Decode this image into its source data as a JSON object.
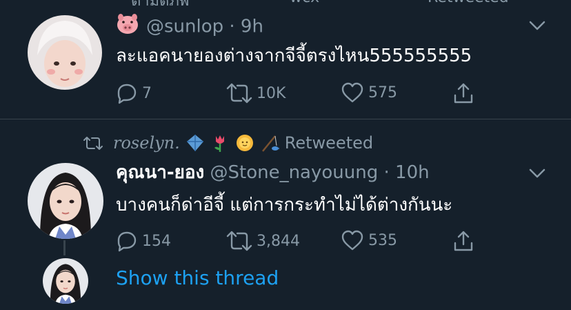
{
  "top_clipped": {
    "left_text": "ตามดูภพ",
    "middle_text": "wcx",
    "right_text": "Retweeted"
  },
  "tweet1": {
    "emoji": "pig",
    "handle": "@sunlop",
    "time": "· 9h",
    "text": "ละแอคนายองต่างจากจีจี้ตรงไหน555555555",
    "replies": "7",
    "retweets": "10K",
    "likes": "575"
  },
  "tweet2": {
    "retweeted_by": "roselyn.",
    "retweeted_label": "Retweeted",
    "display_name": "คุณนา-ยอง",
    "handle": "@Stone_nayouung",
    "time": "· 10h",
    "text": "บางคนก็ด่าอีจี้ แต่การกระทำไม่ได้ต่างกันนะ",
    "replies": "154",
    "retweets": "3,844",
    "likes": "535"
  },
  "thread": {
    "label": "Show this thread"
  },
  "icons": [
    "reply-icon",
    "retweet-icon",
    "like-icon",
    "share-icon",
    "chevron-down-icon"
  ],
  "colors": {
    "background": "#15202b",
    "secondary_text": "#8899a6",
    "link": "#1da1f2",
    "divider": "#38444d"
  }
}
